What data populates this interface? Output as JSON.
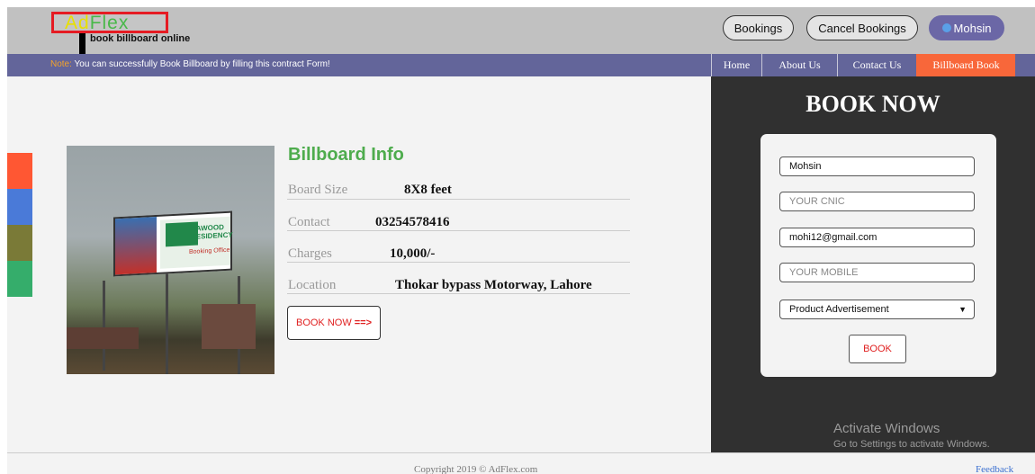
{
  "brand": {
    "logo_part1": "Ad",
    "logo_part2": "Flex",
    "tagline": "book billboard online"
  },
  "header": {
    "bookings_label": "Bookings",
    "cancel_bookings_label": "Cancel Bookings",
    "user_name": "Mohsin"
  },
  "notice": {
    "label": "Note:",
    "text": " You can successfully Book Billboard by filling this contract Form!"
  },
  "nav": {
    "items": [
      {
        "label": "Home"
      },
      {
        "label": "About Us"
      },
      {
        "label": "Contact Us"
      },
      {
        "label": "Billboard Book"
      }
    ]
  },
  "side_colors": [
    "#ff5733",
    "#4a7ad8",
    "#7a7a37",
    "#35ad6b"
  ],
  "billboard": {
    "title": "Billboard Info",
    "rows": [
      {
        "label": "Board Size",
        "value": "8X8 feet"
      },
      {
        "label": "Contact",
        "value": "03254578416"
      },
      {
        "label": "Charges",
        "value": "10,000/-"
      },
      {
        "label": "Location",
        "value": "Thokar bypass Motorway, Lahore"
      }
    ],
    "book_button": "BOOK NOW",
    "book_arrow": "==>",
    "image_text": [
      "DAWOOD",
      "RESIDENCY",
      "Booking Office"
    ]
  },
  "booking_form": {
    "title": "BOOK NOW",
    "name_value": "Mohsin",
    "cnic_placeholder": "YOUR CNIC",
    "email_value": "mohi12@gmail.com",
    "mobile_placeholder": "YOUR MOBILE",
    "ad_type": "Product Advertisement",
    "submit_label": "BOOK"
  },
  "watermark": {
    "line1": "Activate Windows",
    "line2": "Go to Settings to activate Windows."
  },
  "footer": {
    "copyright": "Copyright 2019 © AdFlex.com",
    "feedback": "Feedback"
  }
}
